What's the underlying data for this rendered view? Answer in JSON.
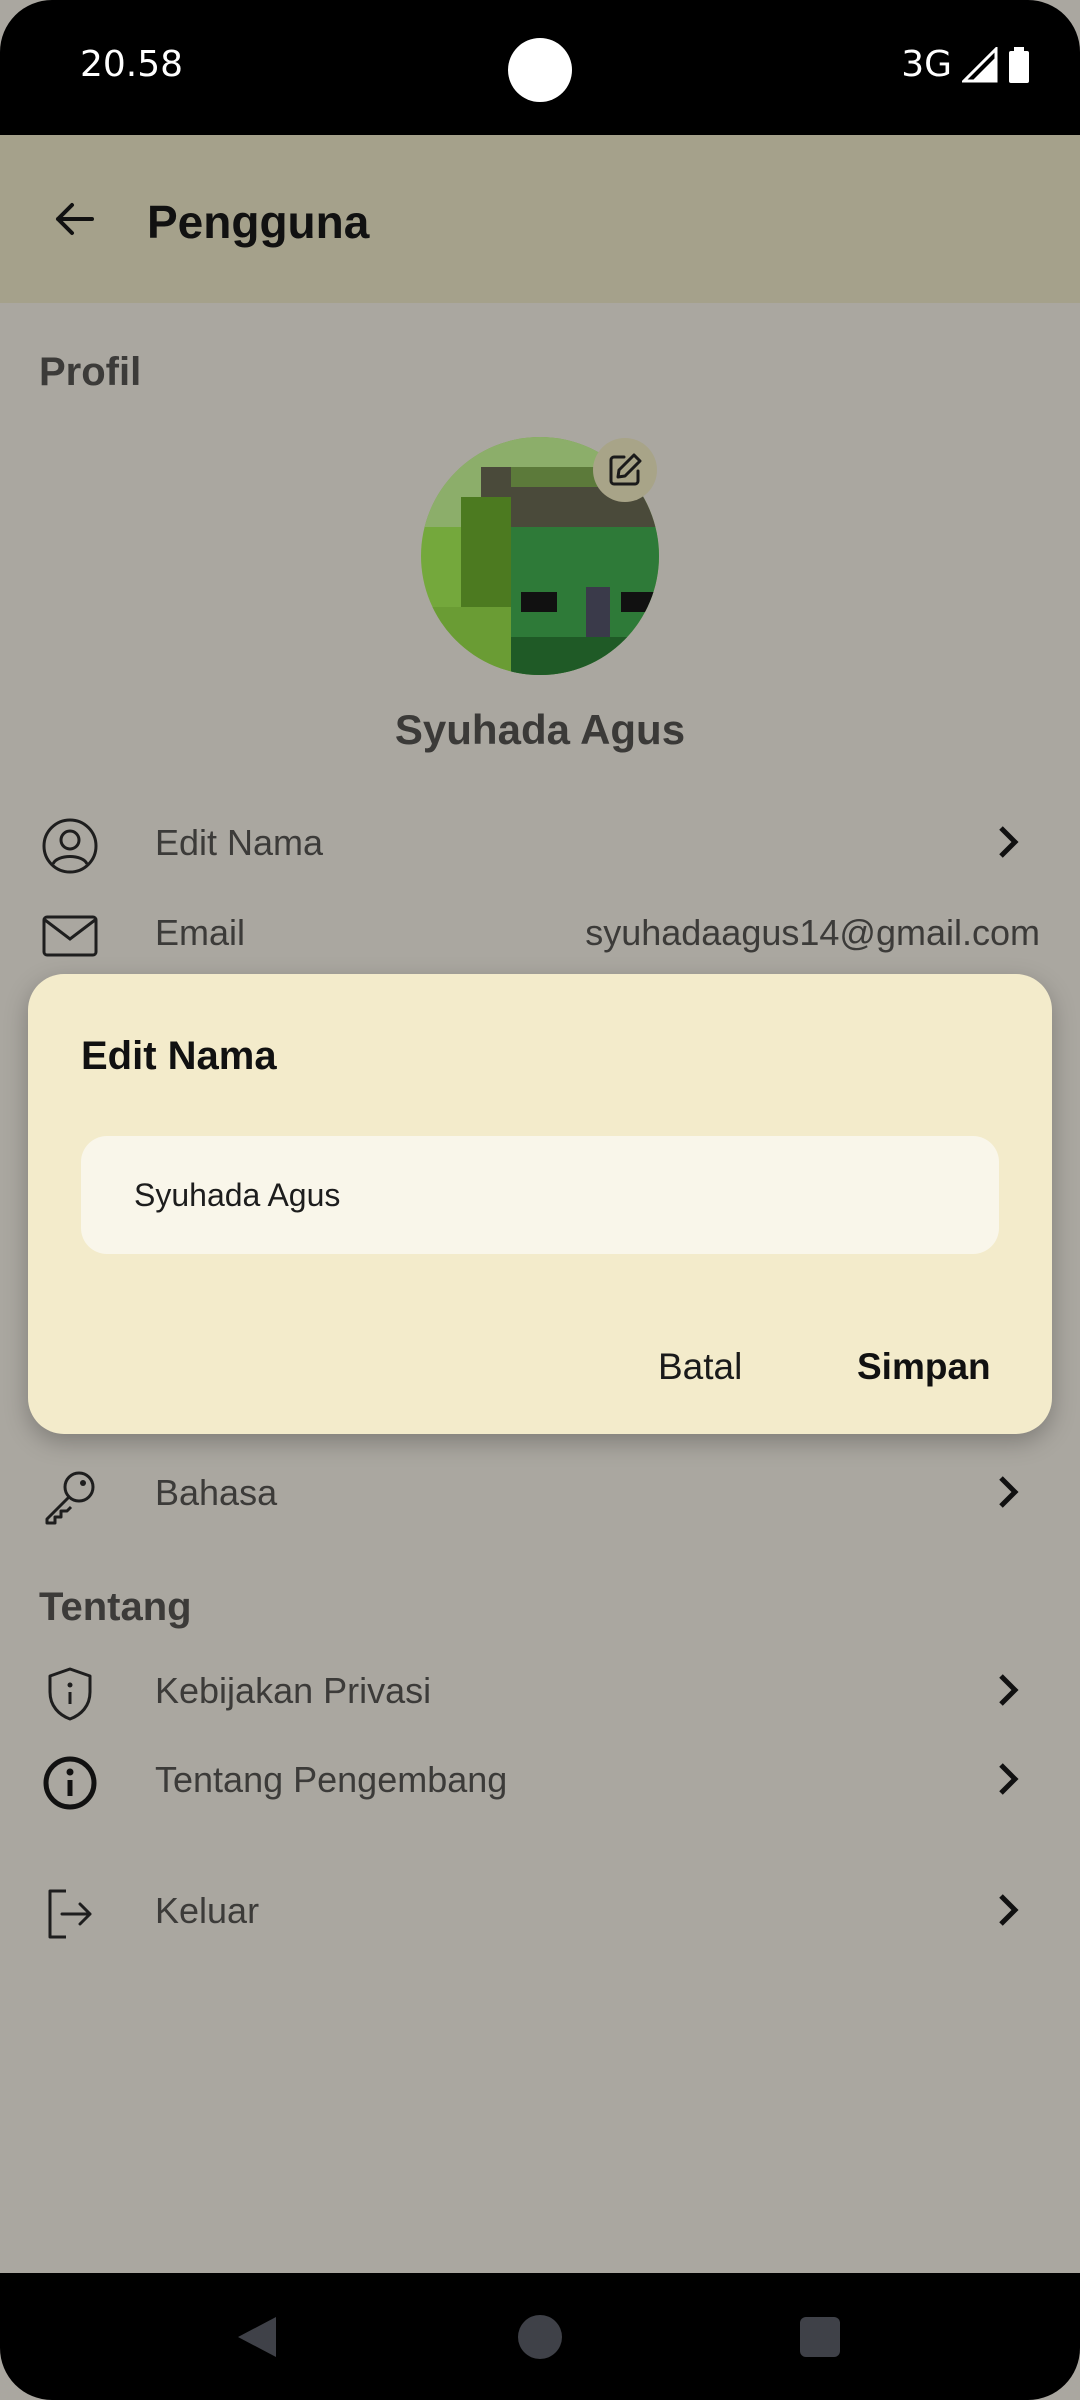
{
  "status_bar": {
    "time": "20.58",
    "network": "3G"
  },
  "app_bar": {
    "title": "Pengguna"
  },
  "profile": {
    "section_title": "Profil",
    "name": "Syuhada Agus",
    "rows": [
      {
        "label": "Edit Nama",
        "icon": "user-circle-icon"
      },
      {
        "label": "Email",
        "value": "syuhadaagus14@gmail.com",
        "icon": "mail-icon"
      },
      {
        "label": "Bahasa",
        "icon": "key-icon"
      }
    ]
  },
  "about": {
    "section_title": "Tentang",
    "rows": [
      {
        "label": "Kebijakan Privasi",
        "icon": "shield-icon"
      },
      {
        "label": "Tentang Pengembang",
        "icon": "info-icon"
      }
    ]
  },
  "logout": {
    "label": "Keluar",
    "icon": "logout-icon"
  },
  "dialog": {
    "title": "Edit Nama",
    "input_value": "Syuhada Agus",
    "cancel_label": "Batal",
    "save_label": "Simpan"
  },
  "colors": {
    "app_bar": "#a5a18b",
    "background": "#aaa7a0",
    "dialog": "#f3ebcb",
    "input": "#f9f6ea"
  }
}
